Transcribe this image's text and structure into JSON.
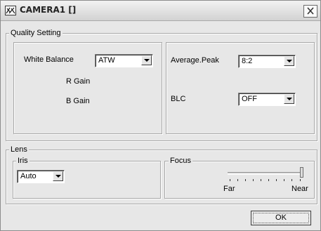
{
  "window": {
    "title": "CAMERA1  []",
    "app_icon": "camera-settings-icon",
    "close_icon": "close-icon"
  },
  "quality": {
    "legend": "Quality Setting",
    "white_balance_label": "White Balance",
    "white_balance_value": "ATW",
    "r_gain_label": "R Gain",
    "b_gain_label": "B Gain",
    "average_peak_label": "Average.Peak",
    "average_peak_value": "8:2",
    "blc_label": "BLC",
    "blc_value": "OFF"
  },
  "lens": {
    "legend": "Lens",
    "iris_legend": "Iris",
    "iris_value": "Auto",
    "focus_legend": "Focus",
    "focus_far_label": "Far",
    "focus_near_label": "Near",
    "focus_level": 1.0
  },
  "ok_label": "OK",
  "colors": {
    "dialog_bg": "#e7e7e7",
    "border": "#a8a8a8"
  }
}
